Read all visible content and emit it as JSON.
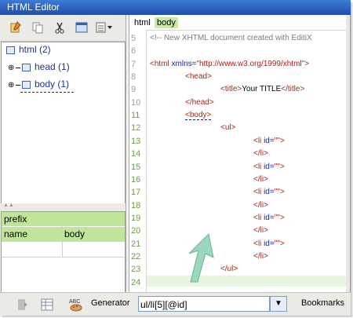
{
  "window": {
    "title": "HTML Editor"
  },
  "toolbar": {
    "icons": [
      "notes-icon",
      "copy-icon",
      "cut-icon",
      "window-icon",
      "properties-dropdown-icon"
    ]
  },
  "tree": {
    "root": {
      "label": "html (2)"
    },
    "children": [
      {
        "label": "head (1)"
      },
      {
        "label": "body (1)"
      }
    ]
  },
  "attributes": {
    "rows": [
      {
        "name": "prefix",
        "value": ""
      },
      {
        "name": "name",
        "value": "body"
      }
    ]
  },
  "editor": {
    "breadcrumb": [
      "html",
      "body"
    ],
    "lines": [
      {
        "n": "5",
        "text": "<!-- New XHTML document created with EditiX"
      },
      {
        "n": "6",
        "text": ""
      },
      {
        "n": "7",
        "text": "<html xmlns=\"http://www.w3.org/1999/xhtml\">"
      },
      {
        "n": "8",
        "text": "<head>"
      },
      {
        "n": "9",
        "text": "<title>Your TITLE</title>"
      },
      {
        "n": "10",
        "text": "</head>"
      },
      {
        "n": "11",
        "text": "<body>"
      },
      {
        "n": "12",
        "text": "<ul>"
      },
      {
        "n": "13",
        "text": "<li id=\"\">"
      },
      {
        "n": "14",
        "text": "</li>"
      },
      {
        "n": "15",
        "text": "<li id=\"\">"
      },
      {
        "n": "16",
        "text": "</li>"
      },
      {
        "n": "17",
        "text": "<li id=\"\">"
      },
      {
        "n": "18",
        "text": "</li>"
      },
      {
        "n": "19",
        "text": "<li id=\"\">"
      },
      {
        "n": "20",
        "text": "</li>"
      },
      {
        "n": "21",
        "text": "<li id=\"\">"
      },
      {
        "n": "22",
        "text": "</li>"
      },
      {
        "n": "23",
        "text": "</ul>"
      },
      {
        "n": "24",
        "text": ""
      }
    ]
  },
  "bottombar": {
    "generator_label": "Generator",
    "generator_value": "ul/li[5][@id]",
    "bookmarks_label": "Bookmarks"
  },
  "colors": {
    "highlight": "#c8eaa4",
    "accent_arrow": "#8fd4b4",
    "titlebar": "#2a5fbf"
  }
}
